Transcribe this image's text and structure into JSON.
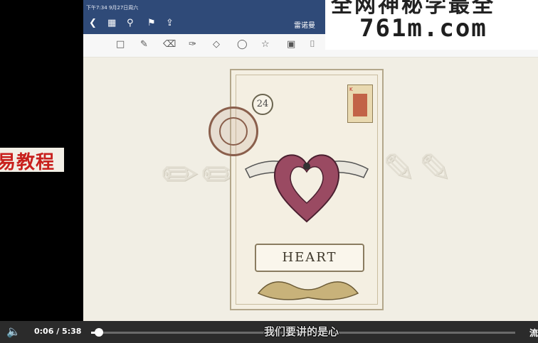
{
  "side_banner": {
    "text": "易教程"
  },
  "ipad": {
    "status_time": "下午7:34   9月27日周六",
    "doc_title": "雷诺曼",
    "nav_icons": [
      "chevron-left-icon",
      "grid-icon",
      "search-icon",
      "bookmark-icon",
      "share-icon"
    ],
    "tool_icons": [
      "page-icon",
      "pen-icon",
      "eraser-icon",
      "highlighter-icon",
      "shapes-icon",
      "lasso-icon",
      "sticker-icon",
      "image-icon",
      "text-icon"
    ]
  },
  "card": {
    "number": "24",
    "banner_text": "HEART",
    "mini_card_rank": "K"
  },
  "watermark": {
    "top_text": "全网神秘学最全",
    "url": "761m.com"
  },
  "player": {
    "time": "0:06 / 5:38",
    "progress_fraction": 0.018,
    "subtitle": "我们要讲的是心",
    "right_label": "流"
  },
  "colors": {
    "topbar": "#2f4a78",
    "banner_red": "#c8201d",
    "heart": "#9a4a62"
  }
}
